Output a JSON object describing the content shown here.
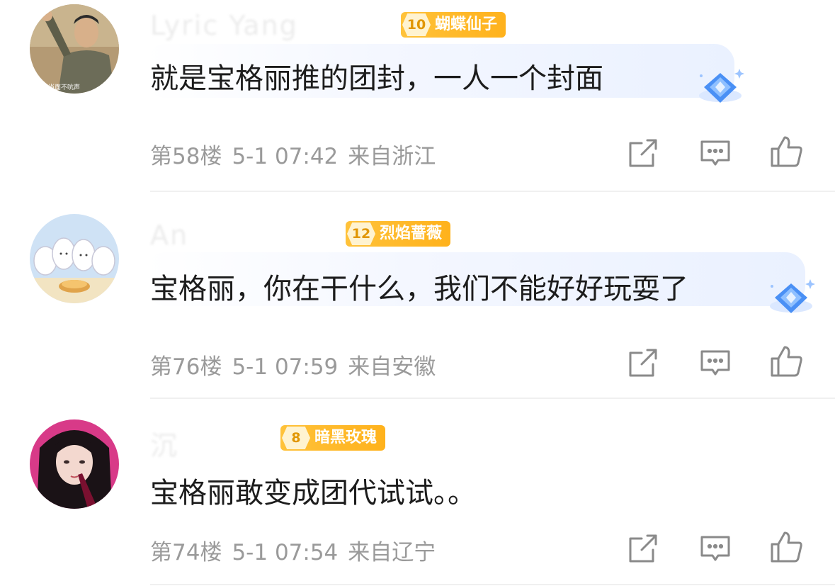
{
  "comments": [
    {
      "username": "Lyric Yang",
      "badge_level": "10",
      "badge_name": "蝴蝶仙子",
      "text": "就是宝格丽推的团封，一人一个封面",
      "floor": "第58楼",
      "time": "5-1 07:42",
      "location": "来自浙江",
      "avatar_caption": "当面不吭声"
    },
    {
      "username": "An",
      "badge_level": "12",
      "badge_name": "烈焰蔷薇",
      "text": "宝格丽，你在干什么，我们不能好好玩耍了",
      "floor": "第76楼",
      "time": "5-1 07:59",
      "location": "来自安徽"
    },
    {
      "username": "沉",
      "badge_level": "8",
      "badge_name": "暗黑玫瑰",
      "text": "宝格丽敢变成团代试试。。",
      "floor": "第74楼",
      "time": "5-1 07:54",
      "location": "来自辽宁"
    }
  ],
  "icons": {
    "share": "share-icon",
    "comment": "comment-icon",
    "like": "thumbs-up-icon"
  },
  "colors": {
    "badge": "#FFB21C",
    "meta_text": "#9A9A9A",
    "gem": "#4A90F5"
  }
}
